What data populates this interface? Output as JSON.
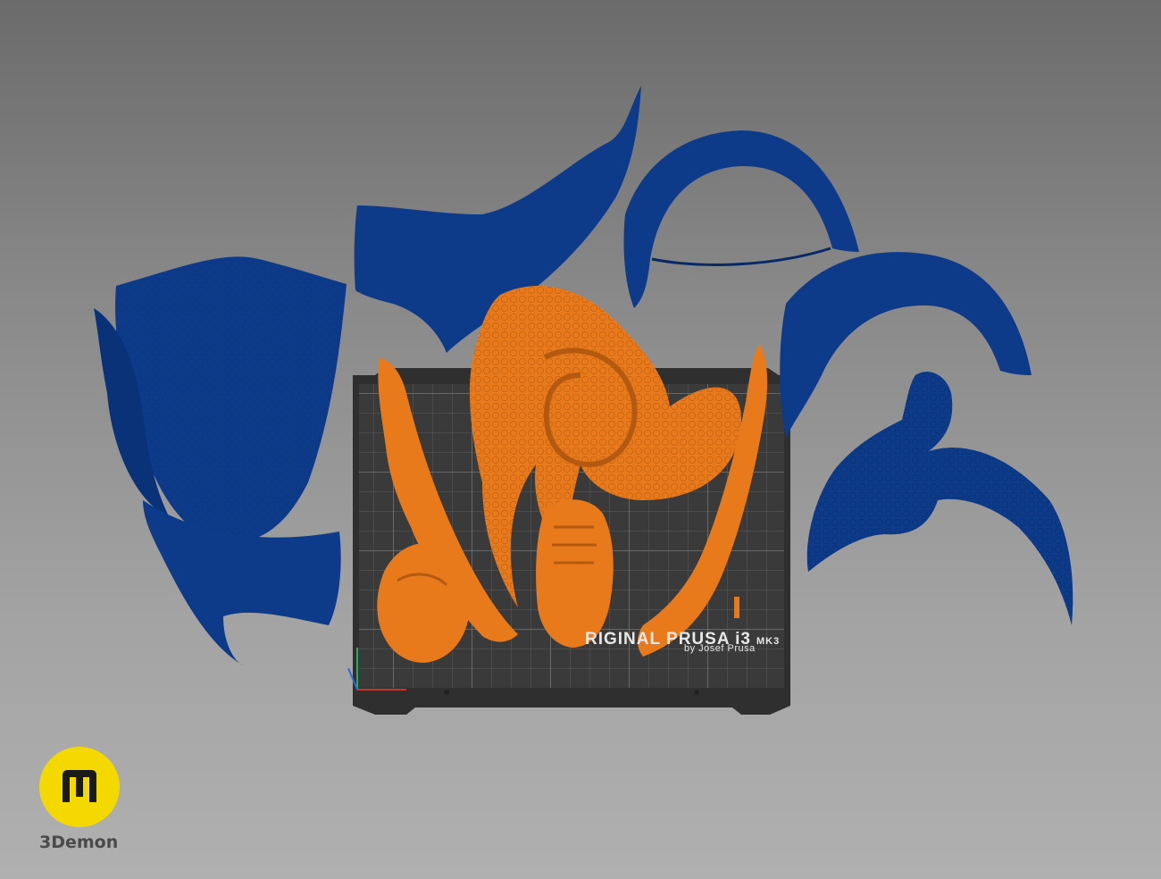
{
  "bed": {
    "title": "RIGINAL PRUSA i3",
    "model": "MK3",
    "subtitle": "by Josef Prusa"
  },
  "brand": {
    "name": "3Demon",
    "logo_icon": "3demon-logo-icon"
  },
  "colors": {
    "background": "#8a8a8a",
    "parts_blue": "#0d3b8a",
    "parts_orange": "#e97a1c",
    "bed_dark": "#3a3a3a",
    "grid_line": "#5a5a5a",
    "logo_yellow": "#f4d900"
  }
}
